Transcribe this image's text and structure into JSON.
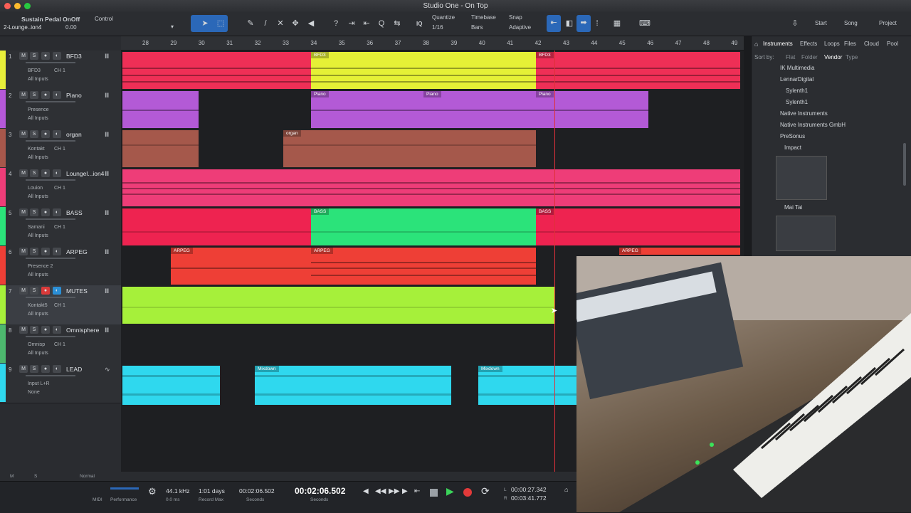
{
  "window": {
    "title": "Studio One - On Top"
  },
  "toolbar": {
    "sustain_label": "Sustain Pedal OnOff",
    "track_label": "2-Lounge..ion4",
    "sustain_value": "0.00",
    "control_label": "Control",
    "iq_label": "IQ",
    "quantize_label": "Quantize",
    "quantize_value": "1/16",
    "timebase_label": "Timebase",
    "timebase_value": "Bars",
    "snap_label": "Snap",
    "snap_value": "Adaptive",
    "start_btn": "Start",
    "song_btn": "Song",
    "project_btn": "Project"
  },
  "ruler": {
    "ticks": [
      "28",
      "29",
      "30",
      "31",
      "32",
      "33",
      "34",
      "35",
      "36",
      "37",
      "38",
      "39",
      "40",
      "41",
      "42",
      "43",
      "44",
      "45",
      "46",
      "47",
      "48",
      "49"
    ]
  },
  "tracks": [
    {
      "num": "1",
      "name": "BFD3",
      "sub1": "BFD3",
      "sub1b": "CH 1",
      "sub2": "All Inputs",
      "color": "#e8ef3a"
    },
    {
      "num": "2",
      "name": "Piano",
      "sub1": "Presence",
      "sub1b": "",
      "sub2": "All Inputs",
      "color": "#b558d8"
    },
    {
      "num": "3",
      "name": "organ",
      "sub1": "Kontakt",
      "sub1b": "CH 1",
      "sub2": "All Inputs",
      "color": "#a7574b"
    },
    {
      "num": "4",
      "name": "Loungel...ion4",
      "sub1": "Louion",
      "sub1b": "CH 1",
      "sub2": "All Inputs",
      "color": "#ee3d78"
    },
    {
      "num": "5",
      "name": "BASS",
      "sub1": "Samani",
      "sub1b": "CH 1",
      "sub2": "All Inputs",
      "color": "#2be37a"
    },
    {
      "num": "6",
      "name": "ARPEG",
      "sub1": "Presence 2",
      "sub1b": "",
      "sub2": "All Inputs",
      "color": "#ee3f36"
    },
    {
      "num": "7",
      "name": "MUTES",
      "sub1": "Kontakt5",
      "sub1b": "CH 1",
      "sub2": "All Inputs",
      "color": "#a6f03a"
    },
    {
      "num": "8",
      "name": "Omnisphere",
      "sub1": "Omnisp",
      "sub1b": "CH 1",
      "sub2": "All Inputs",
      "color": "#4db86e"
    },
    {
      "num": "9",
      "name": "LEAD",
      "sub1": "Input L+R",
      "sub1b": "",
      "sub2": "None",
      "color": "#2fd8ee"
    }
  ],
  "clip_labels": {
    "bfd3": "BFD3",
    "piano": "Piano",
    "organ": "organ",
    "bass": "BASS",
    "arpeg": "ARPEG",
    "mixdown": "Mixdown"
  },
  "browser": {
    "tabs": [
      "Instruments",
      "Effects",
      "Loops",
      "Files",
      "Cloud",
      "Pool"
    ],
    "sort_by": "Sort by:",
    "sort_opts": [
      "Flat",
      "Folder",
      "Vendor",
      "Type"
    ],
    "rows": [
      "IK Multimedia",
      "LennarDigital",
      "Sylenth1",
      "Sylenth1",
      "Native Instruments",
      "Native Instruments GmbH",
      "PreSonus",
      "Impact",
      "Mai Tai"
    ]
  },
  "transport": {
    "midi": "MIDI",
    "performance": "Performance",
    "sample_rate": "44.1 kHz",
    "latency": "0.0 ms",
    "record_time": "1:01 days",
    "record_max": "Record Max",
    "seconds_value": "00:02:06.502",
    "seconds_label": "Seconds",
    "main_time": "00:02:06.502",
    "main_label": "Seconds",
    "loop_l": "00:00:27.342",
    "loop_r": "00:03:41.772",
    "l": "L",
    "r": "R"
  },
  "status": {
    "m": "M",
    "s": "S",
    "zoom": "Normal"
  }
}
